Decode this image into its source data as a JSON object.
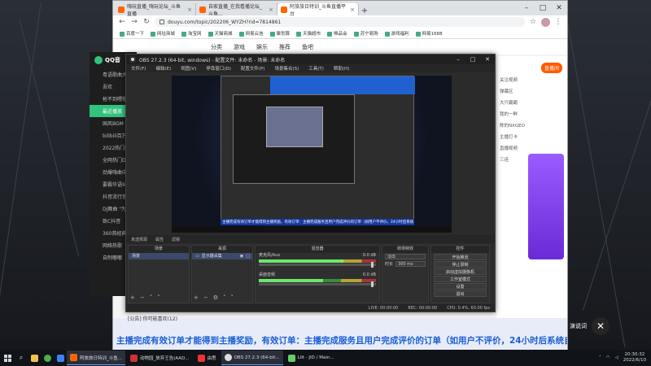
{
  "browser": {
    "tabs": [
      {
        "label": "嗨玩直播_嗨玩论坛_斗鱼直播"
      },
      {
        "label": "自家直播_在我看播论坛_斗鱼..."
      },
      {
        "label": "阿旅旅日特训_斗鱼直播平台"
      }
    ],
    "url": "douyu.com/topic/202206_WYZH?rid=7814861",
    "bookmarks": [
      "百度一下",
      "网址商城",
      "淘宝网",
      "天猫商城",
      "网易云信",
      "聚划算",
      "天猫超市",
      "唯品会",
      "苏宁易购",
      "游戏福利",
      "网易1688"
    ],
    "site_nav": [
      "分类",
      "游戏",
      "娱乐",
      "推荐",
      "鱼吧"
    ],
    "right_panel": {
      "action": "直播间",
      "items": [
        "关注视频",
        "弹幕区",
        "大只霸霸",
        "我的一鲜",
        "陈的NXGEO",
        "主播打卡",
        "直播视频",
        "三连"
      ]
    },
    "banner": "主播完成有效订单才能得到主播奖励，有效订单：主播完成服务且用户完成评价的订单（如用户不评价，24小时后系统自动评价）",
    "notice_row": "[公告] 你可能喜欢(12)"
  },
  "qq": {
    "title": "QQ音",
    "items": [
      "粤语歌曲大全",
      "吾欢",
      "枪不到喂你",
      "最近播放",
      "国风BGM",
      "bilibili百万点",
      "2022热门新星",
      "全网热门DJ",
      "劲爆嗨曲中文",
      "要霸华语90",
      "抖音流行音乐",
      "DJ舞曲 \"为",
      "致C抖音",
      "360首经典单",
      "网络热歌",
      "自制嘟嘟"
    ],
    "active_index": 3
  },
  "obs": {
    "title": "OBS 27.2.3 (64-bit, windows) - 配置文件: 未命名 - 场景: 未命名",
    "menu": [
      "文件(F)",
      "编辑(E)",
      "视图(V)",
      "停靠窗口(D)",
      "配置文件(P)",
      "场景集合(S)",
      "工具(T)",
      "帮助(H)"
    ],
    "scene_tabs": [
      "未选择源",
      "属性",
      "滤镜"
    ],
    "preview_banner": "主播完成有效订单才能得到主播奖励，有效订单：主播完成服务且用户完成评价的订单（如用户不评价，24小时后系统自动评价）",
    "docks": {
      "scenes": {
        "title": "场景",
        "items": [
          "场景"
        ]
      },
      "sources": {
        "title": "来源",
        "items": [
          "显示器采集"
        ]
      },
      "mixer": {
        "title": "混音器",
        "channels": [
          {
            "name": "麦克风/Aux",
            "db": "0.0 dB",
            "level": 0.72
          },
          {
            "name": "桌面音频",
            "db": "0.0 dB",
            "level": 0.55
          }
        ]
      },
      "transitions": {
        "title": "转场特效",
        "type": "淡出",
        "duration_label": "时长",
        "duration": "300 ms"
      },
      "controls": {
        "title": "控件",
        "buttons": [
          "开始推流",
          "停止录制",
          "启动虚拟摄像机",
          "工作室模式",
          "设置",
          "退出"
        ]
      }
    },
    "status": [
      "LIVE: 00:00:00",
      "REC: 00:00:00",
      "CPU: 0.4%, 60.00 fps"
    ]
  },
  "overlay": {
    "close": "✕",
    "side_text": "演说词"
  },
  "taskbar": {
    "apps": [
      {
        "label": "阿旅旅日特训_斗鱼..."
      },
      {
        "label": "动物园_放弃王告(AAD..."
      },
      {
        "label": "由思"
      },
      {
        "label": "OBS 27.2.3 (64-bit..."
      },
      {
        "label": "Lilt - JID / Main..."
      }
    ],
    "time": "20:30:32",
    "date": "2022/6/10"
  }
}
